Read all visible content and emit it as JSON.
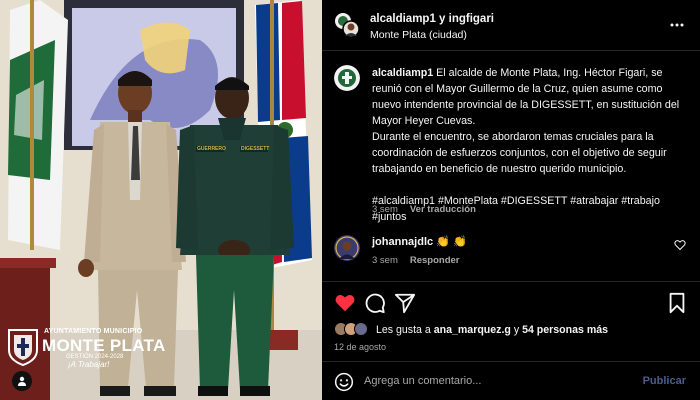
{
  "photo": {
    "branding": {
      "line1": "AYUNTAMIENTO MUNICIPIO",
      "line2": "MONTE PLATA",
      "line3": "GESTIÓN 2024-2028",
      "line4": "¡A Trabajar!"
    },
    "uniform": {
      "left_patch": "GUERRERO",
      "right_patch": "DIGESSETT"
    },
    "user_tag_icon": "person-icon"
  },
  "post": {
    "header": {
      "accounts": "alcaldiamp1 y ingfigari",
      "location": "Monte Plata (ciudad)",
      "more_icon": "more-icon"
    },
    "caption": {
      "username": "alcaldiamp1",
      "paragraph1": "El alcalde de Monte Plata, Ing. Héctor Figari, se reunió con el Mayor Guillermo de la Cruz, quien asume como nuevo intendente provincial de la DIGESSETT, en sustitución del Mayor Heyer Cuevas.",
      "paragraph2": "Durante el encuentro, se abordaron temas cruciales para la coordinación de esfuerzos conjuntos, con el objetivo de seguir trabajando en beneficio de nuestro querido municipio.",
      "hashtags": "#alcaldiamp1 #MontePlata #DIGESSETT #atrabajar #trabajo #juntos",
      "time": "3 sem",
      "translate": "Ver traducción"
    },
    "comment": {
      "username": "johannajdlc",
      "emoji": "👏 👏",
      "time": "3 sem",
      "reply": "Responder",
      "heart_icon": "heart-outline-icon"
    },
    "actions": {
      "like_icon": "heart-filled-icon",
      "comment_icon": "comment-icon",
      "share_icon": "send-icon",
      "save_icon": "bookmark-icon",
      "like_color": "#ff3040"
    },
    "likes": {
      "prefix": "Les gusta a",
      "user": "ana_marquez.g",
      "suffix": "y",
      "others": "54 personas más"
    },
    "date": "12 de agosto",
    "add_comment": {
      "placeholder": "Agrega un comentario...",
      "post_label": "Publicar"
    }
  }
}
